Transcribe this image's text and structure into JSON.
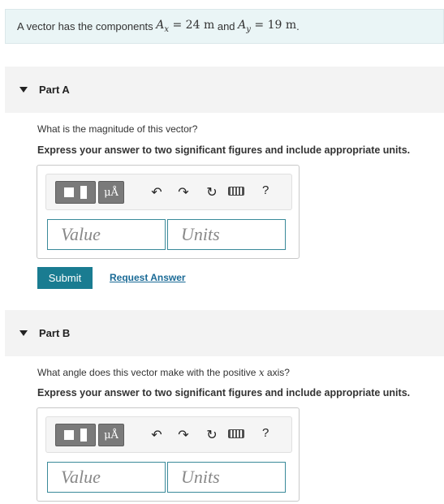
{
  "problem": {
    "prefix": "A vector has the components ",
    "ax_var": "A",
    "ax_sub": "x",
    "ax_eq": " = 24 m",
    "middle": " and ",
    "ay_var": "A",
    "ay_sub": "y",
    "ay_eq": " = 19 m",
    "suffix": "."
  },
  "partA": {
    "title": "Part A",
    "question": "What is the magnitude of this vector?",
    "instruction": "Express your answer to two significant figures and include appropriate units.",
    "value_placeholder": "Value",
    "units_placeholder": "Units",
    "submit_label": "Submit",
    "request_label": "Request Answer"
  },
  "partB": {
    "title": "Part B",
    "question_prefix": "What angle does this vector make with the positive ",
    "question_var": "x",
    "question_suffix": " axis?",
    "instruction": "Express your answer to two significant figures and include appropriate units.",
    "value_placeholder": "Value",
    "units_placeholder": "Units"
  },
  "toolbar": {
    "units_glyph": "μÅ",
    "undo_glyph": "↶",
    "redo_glyph": "↷",
    "reset_glyph": "↻",
    "help_glyph": "?",
    "icons": [
      "templates-icon",
      "units-icon",
      "undo-icon",
      "redo-icon",
      "reset-icon",
      "keyboard-icon",
      "help-icon"
    ]
  }
}
